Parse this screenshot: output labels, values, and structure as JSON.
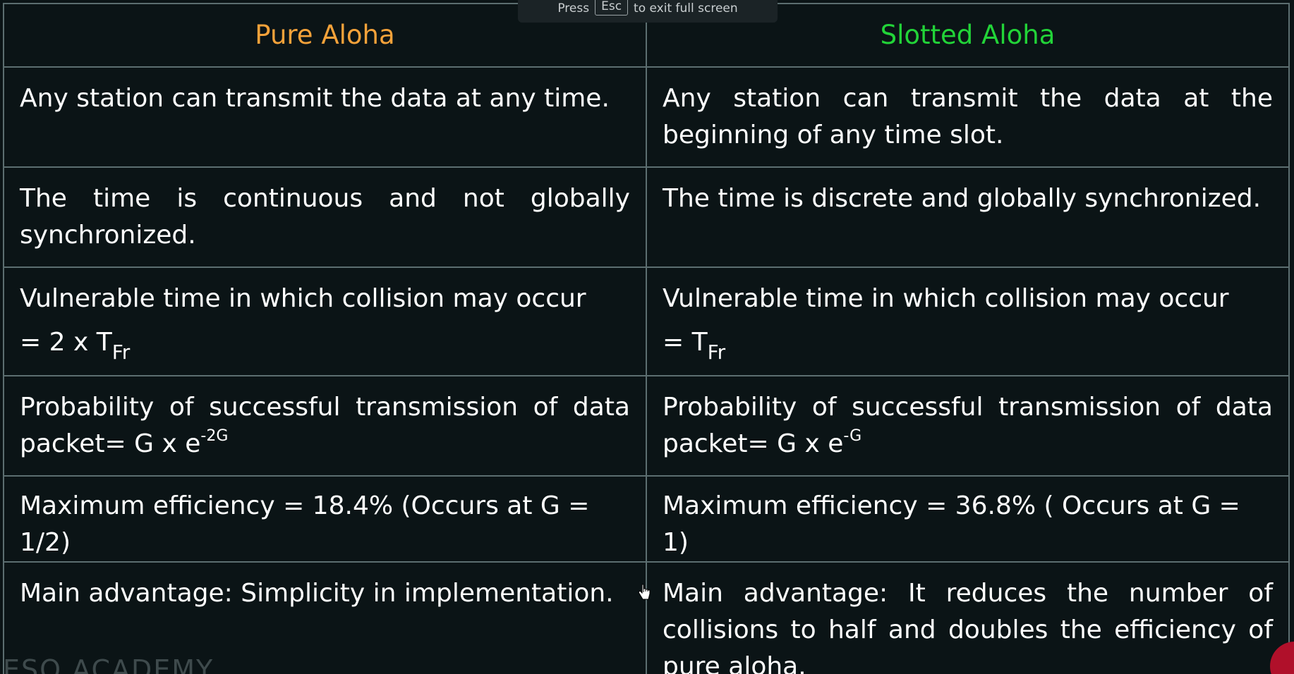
{
  "overlay": {
    "press": "Press",
    "key": "Esc",
    "rest": "to exit full screen"
  },
  "table": {
    "headers": {
      "pure": "Pure Aloha",
      "slotted": "Slotted Aloha"
    },
    "rows": [
      {
        "pure": "Any station can transmit the data at any time.",
        "slotted": "Any station can transmit the data at the beginning of any time slot."
      },
      {
        "pure": "The time is continuous and not globally synchronized.",
        "slotted": "The time is discrete and globally synchronized."
      },
      {
        "pure": "Vulnerable time in which collision may occur",
        "pure_formula": "= 2 x T",
        "pure_sub": "Fr",
        "slotted": "Vulnerable time in which collision may occur",
        "slotted_formula": "= T",
        "slotted_sub": "Fr"
      },
      {
        "pure": "Probability of successful transmission of data packet= G x e",
        "pure_sup": "-2G",
        "slotted": "Probability of successful transmission of data packet= G x e",
        "slotted_sup": "-G"
      },
      {
        "pure": "Maximum efficiency = 18.4% (Occurs at G = 1/2)",
        "slotted": "Maximum efficiency = 36.8% ( Occurs at G = 1)"
      },
      {
        "pure": "Main advantage: Simplicity in implementation.",
        "slotted": "Main advantage: It reduces the number of collisions to half and doubles the efficiency of pure aloha."
      }
    ]
  },
  "watermark": "ESO ACADEMY",
  "colors": {
    "background": "#0b1416",
    "border": "#5c6e70",
    "pure_header": "#f5a23a",
    "slotted_header": "#22d438",
    "text": "#ffffff"
  },
  "icons": {
    "cursor": "hand-pointer-icon",
    "corner": "red-badge-icon"
  }
}
